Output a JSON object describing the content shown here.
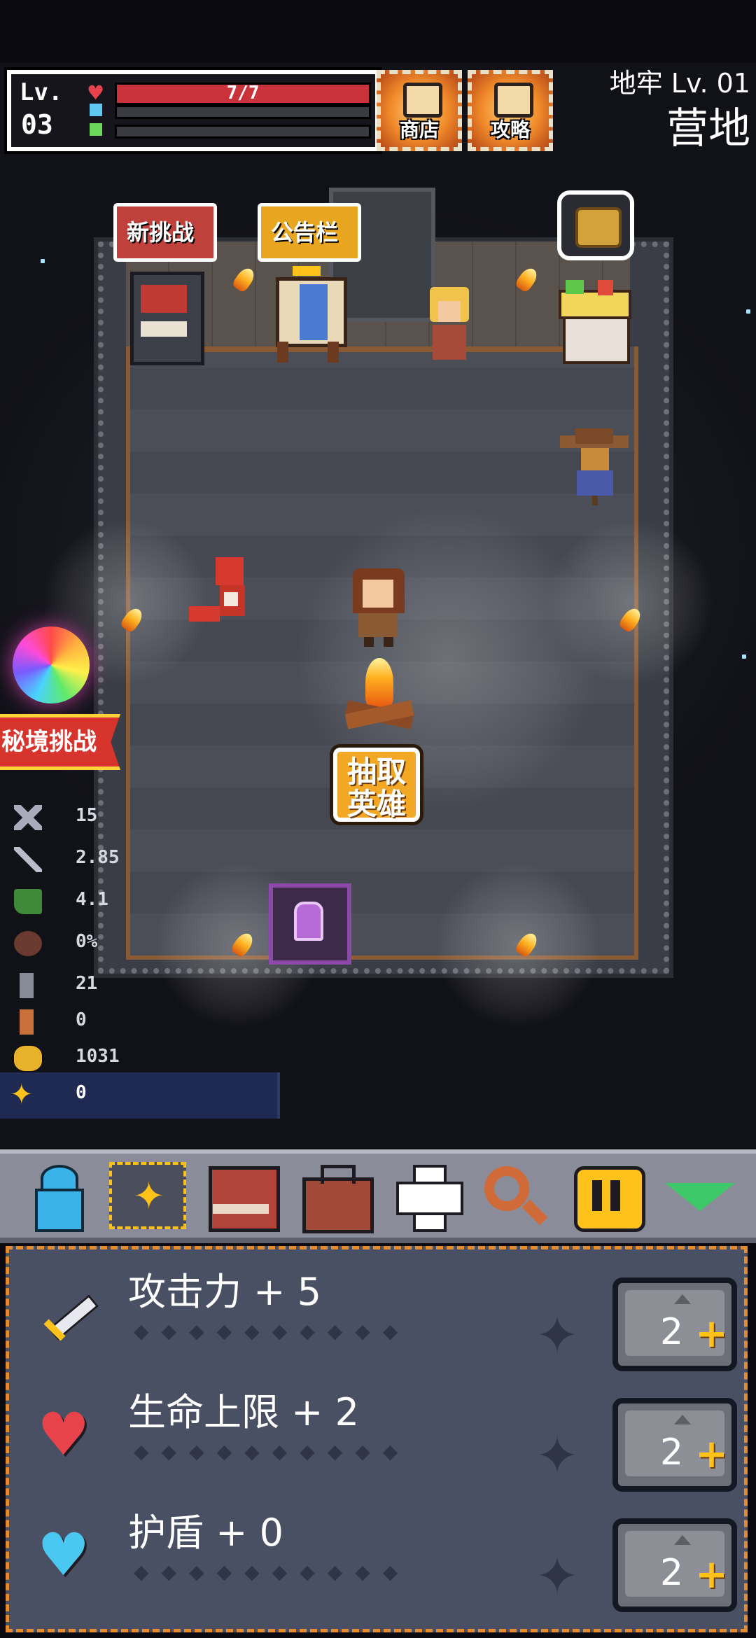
{
  "hud": {
    "lv_label": "Lv.",
    "lv_value": "03",
    "hp_text": "7/7",
    "shop_label": "商店",
    "guide_label": "攻略",
    "dungeon_level": "地牢 Lv. 01",
    "area_name": "营地"
  },
  "room": {
    "sign_new_challenge": "新挑战",
    "sign_board": "公告栏",
    "draw_hero": "抽取英雄",
    "secret_realm": "秘境挑战"
  },
  "stats": [
    {
      "icon": "crossed-swords-icon",
      "value": "15"
    },
    {
      "icon": "sword-icon",
      "value": "2.85"
    },
    {
      "icon": "boot-icon",
      "value": "4.1"
    },
    {
      "icon": "round-shield-icon",
      "value": "0%"
    },
    {
      "icon": "key-gray-icon",
      "value": "21"
    },
    {
      "icon": "key-orange-icon",
      "value": "0"
    },
    {
      "icon": "gold-coin-icon",
      "value": "1031"
    },
    {
      "icon": "gem-sparkle-icon",
      "value": "0"
    }
  ],
  "toolbar": [
    {
      "name": "character-icon",
      "color": "#3ab4e8"
    },
    {
      "name": "upgrade-sparkle-icon",
      "color": "#ffc21a",
      "selected": true
    },
    {
      "name": "book-icon",
      "color": "#b0443a"
    },
    {
      "name": "bag-icon",
      "color": "#a24a38"
    },
    {
      "name": "heal-cross-icon",
      "color": "#ffffff"
    },
    {
      "name": "search-icon",
      "color": "#d06a38"
    },
    {
      "name": "pause-icon",
      "color": "#ffc21a"
    },
    {
      "name": "collapse-triangle-icon",
      "color": "#3fc86a"
    }
  ],
  "upgrades": [
    {
      "label": "攻击力 + 5",
      "cost": "2",
      "icon": "sword-icon"
    },
    {
      "label": "生命上限 + 2",
      "cost": "2",
      "icon": "heart-icon"
    },
    {
      "label": "护盾 + 0",
      "cost": "2",
      "icon": "blue-heart-icon"
    }
  ],
  "colors": {
    "accent": "#f2a825",
    "hp": "#c9323a",
    "panel": "#4a5064",
    "panel_border": "#e58b2f"
  }
}
